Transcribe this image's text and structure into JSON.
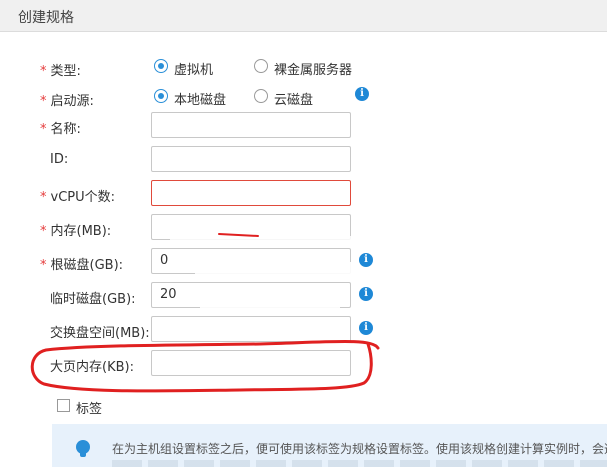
{
  "header": {
    "title": "创建规格"
  },
  "form": {
    "type": {
      "label": "类型:",
      "options": [
        "虚拟机",
        "裸金属服务器"
      ],
      "selected": "虚拟机"
    },
    "boot_source": {
      "label": "启动源:",
      "options": [
        "本地磁盘",
        "云磁盘"
      ],
      "selected": "本地磁盘"
    },
    "name": {
      "label": "名称:",
      "value": ""
    },
    "id": {
      "label": "ID:",
      "value": ""
    },
    "vcpu": {
      "label": "vCPU个数:",
      "value": ""
    },
    "memory": {
      "label": "内存(MB):",
      "value": ""
    },
    "root_disk": {
      "label": "根磁盘(GB):",
      "value": "0"
    },
    "ephemeral_disk": {
      "label": "临时磁盘(GB):",
      "value": "20"
    },
    "swap": {
      "label": "交换盘空间(MB):",
      "value": ""
    },
    "hugepage": {
      "label": "大页内存(KB):",
      "value": ""
    },
    "tags": {
      "label": "标签",
      "checked": false
    }
  },
  "tip": {
    "text": "在为主机组设置标签之后，便可使用该标签为规格设置标签。使用该规格创建计算实例时，会选"
  },
  "colors": {
    "accent": "#2a8fd8",
    "required": "#e53b3b",
    "annotation": "#e02020"
  }
}
